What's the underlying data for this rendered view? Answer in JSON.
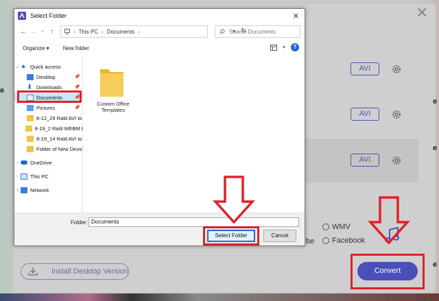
{
  "app": {
    "close_glyph": "✕",
    "format_buttons": [
      "AVI",
      "AVI",
      "AVI"
    ],
    "radio_options": [
      "WMV",
      "Facebook"
    ],
    "truncated_text": "be",
    "install_label": "Install Desktop Version",
    "convert_label": "Convert",
    "edge_chars": [
      "e",
      "e",
      "e"
    ]
  },
  "dialog": {
    "title": "Select Folder",
    "close_glyph": "✕",
    "breadcrumb": [
      "This PC",
      "Documents"
    ],
    "search_placeholder": "Search Documents",
    "toolbar": {
      "organize": "Organize ▾",
      "new_folder": "New folder"
    },
    "tree": [
      {
        "label": "Quick access",
        "icon": "star-icon",
        "level": 0
      },
      {
        "label": "Desktop",
        "icon": "desktop-icon",
        "level": 1,
        "pinned": true
      },
      {
        "label": "Downloads",
        "icon": "download-icon",
        "level": 1,
        "pinned": true
      },
      {
        "label": "Documents",
        "icon": "documents-icon",
        "level": 1,
        "pinned": true,
        "selected": true
      },
      {
        "label": "Pictures",
        "icon": "pictures-icon",
        "level": 1,
        "pinned": true
      },
      {
        "label": "8-12_29 Rald AVI to",
        "icon": "folder-icon",
        "level": 1
      },
      {
        "label": "8-19_2 Rald WEBM t",
        "icon": "folder-icon",
        "level": 1
      },
      {
        "label": "8-19_14 Rald AVI to",
        "icon": "folder-icon",
        "level": 1
      },
      {
        "label": "Folder of New Devic",
        "icon": "folder-icon",
        "level": 1
      },
      {
        "label": "OneDrive",
        "icon": "cloud-icon",
        "level": 0
      },
      {
        "label": "This PC",
        "icon": "pc-icon",
        "level": 0
      },
      {
        "label": "Network",
        "icon": "network-icon",
        "level": 0
      }
    ],
    "folder_item": {
      "name": "Custom Office Templates"
    },
    "footer": {
      "folder_label": "Folder:",
      "folder_value": "Documents",
      "select_label": "Select Folder",
      "cancel_label": "Cancel"
    }
  },
  "colors": {
    "accent": "#4b4fb8",
    "highlight_red": "#e0202a",
    "win_blue": "#1a6ad4"
  }
}
